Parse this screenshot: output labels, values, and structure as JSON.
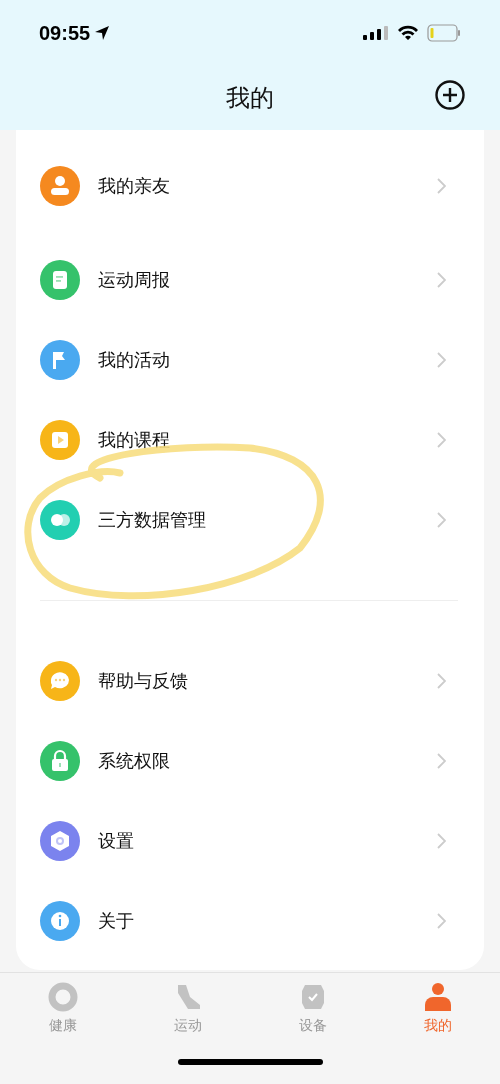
{
  "status_bar": {
    "time": "09:55"
  },
  "header": {
    "title": "我的"
  },
  "sections": [
    {
      "items": [
        {
          "label": "我的亲友",
          "color": "#f5891f"
        }
      ]
    },
    {
      "items": [
        {
          "label": "运动周报",
          "color": "#35c26b"
        },
        {
          "label": "我的活动",
          "color": "#4aa9f0"
        },
        {
          "label": "我的课程",
          "color": "#f7b518"
        },
        {
          "label": "三方数据管理",
          "color": "#22cfb1"
        }
      ]
    },
    {
      "items": [
        {
          "label": "帮助与反馈",
          "color": "#f7b518"
        },
        {
          "label": "系统权限",
          "color": "#35c26b"
        },
        {
          "label": "设置",
          "color": "#7b83ee"
        },
        {
          "label": "关于",
          "color": "#4aa9f0"
        }
      ]
    }
  ],
  "tab_bar": [
    {
      "label": "健康",
      "selected": false
    },
    {
      "label": "运动",
      "selected": false
    },
    {
      "label": "设备",
      "selected": false
    },
    {
      "label": "我的",
      "selected": true
    }
  ]
}
